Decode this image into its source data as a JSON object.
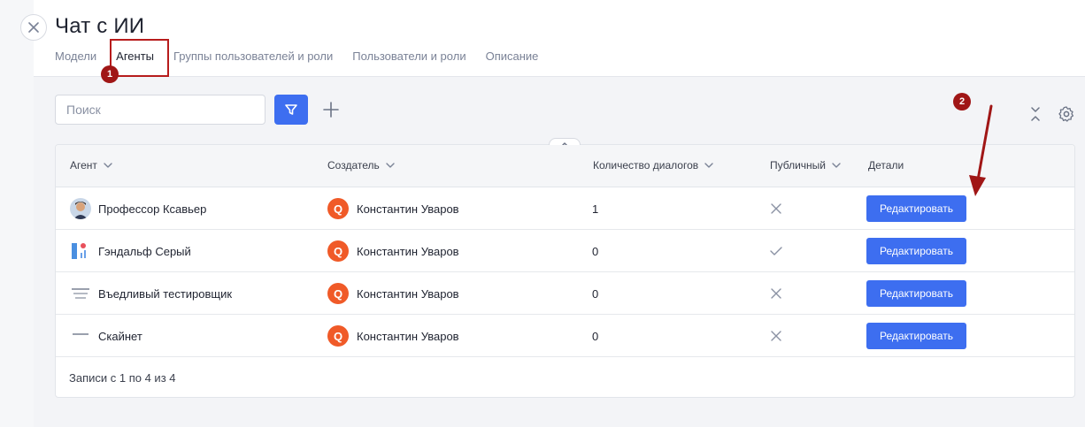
{
  "header": {
    "title": "Чат с ИИ",
    "tabs": [
      {
        "label": "Модели",
        "active": false
      },
      {
        "label": "Агенты",
        "active": true
      },
      {
        "label": "Группы пользователей и роли",
        "active": false
      },
      {
        "label": "Пользователи и роли",
        "active": false
      },
      {
        "label": "Описание",
        "active": false
      }
    ]
  },
  "toolbar": {
    "search_placeholder": "Поиск",
    "filter_icon": "filter-icon",
    "add_icon": "plus-icon",
    "collapse_icon": "collapse-icon",
    "settings_icon": "gear-icon"
  },
  "table": {
    "columns": {
      "agent": "Агент",
      "creator": "Создатель",
      "dialogs": "Количество диалогов",
      "public": "Публичный",
      "details": "Детали"
    },
    "rows": [
      {
        "agent": "Профессор Ксавьер",
        "creator_initial": "Q",
        "creator": "Константин Уваров",
        "dialogs": "1",
        "public": false,
        "action": "Редактировать"
      },
      {
        "agent": "Гэндальф Серый",
        "creator_initial": "Q",
        "creator": "Константин Уваров",
        "dialogs": "0",
        "public": true,
        "action": "Редактировать"
      },
      {
        "agent": "Въедливый тестировщик",
        "creator_initial": "Q",
        "creator": "Константин Уваров",
        "dialogs": "0",
        "public": false,
        "action": "Редактировать"
      },
      {
        "agent": "Скайнет",
        "creator_initial": "Q",
        "creator": "Константин Уваров",
        "dialogs": "0",
        "public": false,
        "action": "Редактировать"
      }
    ],
    "footer": "Записи с 1 по 4 из 4"
  },
  "annotations": {
    "badge1": "1",
    "badge2": "2",
    "color": "#a01616"
  },
  "colors": {
    "accent": "#3d6ef0",
    "user_avatar": "#f05a28"
  }
}
